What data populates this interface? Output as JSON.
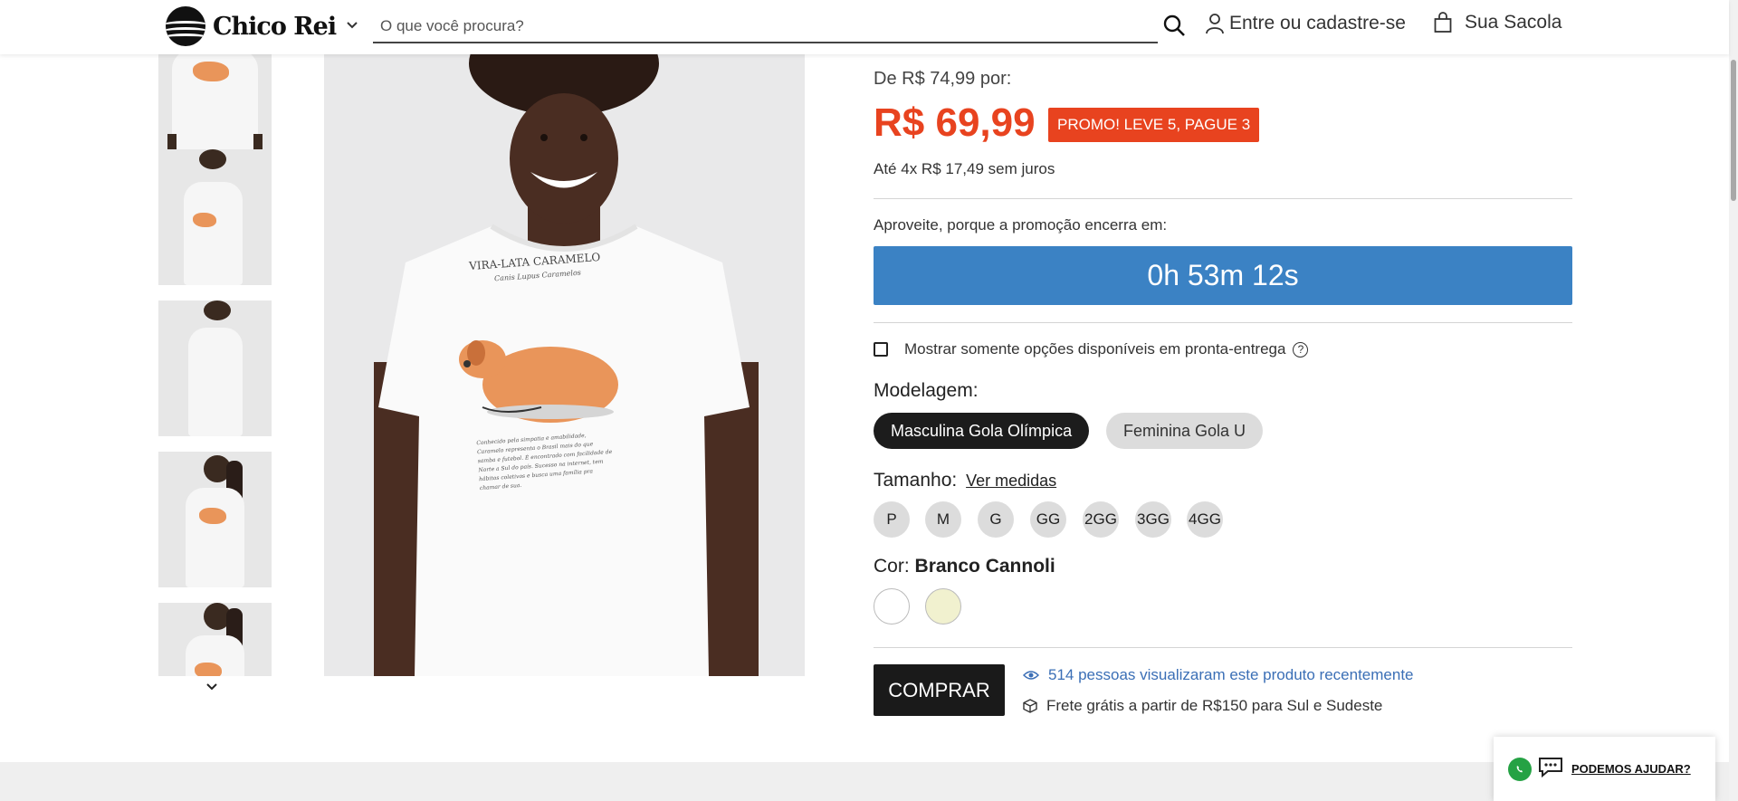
{
  "header": {
    "logo_text": "Chico Rei",
    "search_placeholder": "O que você procura?",
    "login_label": "Entre ou cadastre-se",
    "bag_label": "Sua Sacola",
    "icons": [
      "logo-icon",
      "chevron-down-icon",
      "search-icon",
      "user-icon",
      "bag-icon"
    ]
  },
  "gallery": {
    "thumbnail_count": 5,
    "main_image_text": {
      "shirt_title": "VIRA-LATA CARAMELO",
      "shirt_subtitle": "Canis Lupus Caramelos",
      "shirt_paragraph": "Conhecido pela simpatia e amabilidade, Caramelo representa o Brasil mais do que samba e futebol. É encontrado com facilidade de Norte a Sul do país. Sucesso na internet, tem hábitos coletivos e busca uma família pra chamar de sua."
    }
  },
  "product": {
    "price_from": "De R$ 74,99 por:",
    "price": "R$ 69,99",
    "promo_badge": "PROMO! LEVE 5, PAGUE 3",
    "installments": "Até 4x R$ 17,49 sem juros",
    "countdown_label": "Aproveite, porque a promoção encerra em:",
    "countdown": "0h 53m 12s",
    "stock_filter_label": "Mostrar somente opções disponíveis em pronta-entrega",
    "stock_filter_checked": false,
    "model_label": "Modelagem:",
    "models": [
      {
        "label": "Masculina Gola Olímpica",
        "selected": true
      },
      {
        "label": "Feminina Gola U",
        "selected": false
      }
    ],
    "size_label": "Tamanho:",
    "size_guide_link": "Ver medidas",
    "sizes": [
      "P",
      "M",
      "G",
      "GG",
      "2GG",
      "3GG",
      "4GG"
    ],
    "color_label": "Cor:",
    "color_value": "Branco Cannoli",
    "colors": [
      {
        "name": "Branco",
        "hex": "#ffffff"
      },
      {
        "name": "Cannoli",
        "hex": "#f1f1cf"
      }
    ],
    "buy_label": "COMPRAR",
    "views_text": "514 pessoas visualizaram este produto recentemente",
    "shipping_text": "Frete grátis a partir de R$150 para Sul e Sudeste"
  },
  "help_widget": {
    "label": "PODEMOS AJUDAR?"
  },
  "colors": {
    "price_red": "#e8431f",
    "countdown_blue": "#3b82c4",
    "views_blue": "#3b6fb6",
    "button_dark": "#1a1a1a",
    "whatsapp_green": "#25a244"
  }
}
